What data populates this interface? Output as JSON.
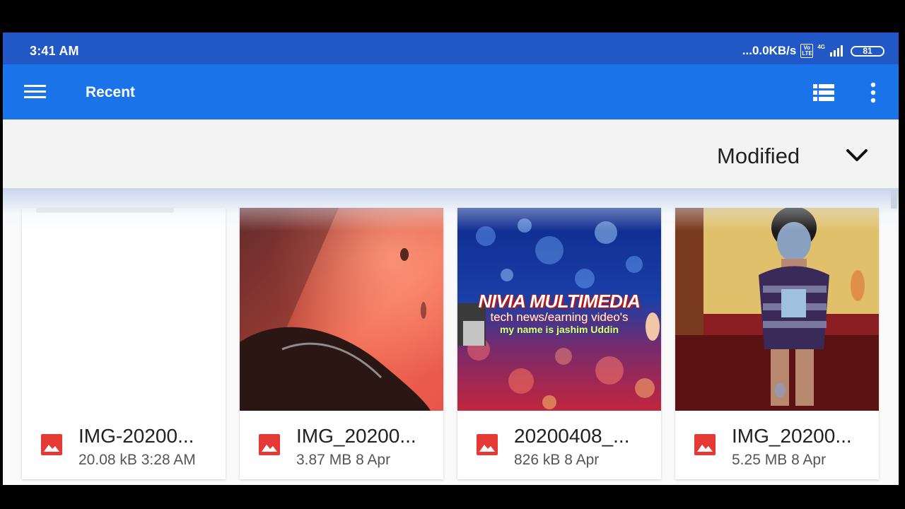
{
  "status_bar": {
    "time": "3:41 AM",
    "speed": "...0.0KB/s",
    "volte": "Vo LTE",
    "network": "4G",
    "battery": "81"
  },
  "app_bar": {
    "title": "Recent",
    "icons": [
      "menu-icon",
      "list-view-icon",
      "more-vert-icon"
    ]
  },
  "sort": {
    "label": "Modified",
    "icon": "chevron-down-icon"
  },
  "files": [
    {
      "name": "IMG-20200...",
      "size": "20.08 kB",
      "date": "3:28 AM",
      "icon": "image-icon"
    },
    {
      "name": "IMG_20200...",
      "size": "3.87 MB",
      "date": "8 Apr",
      "icon": "image-icon"
    },
    {
      "name": "20200408_...",
      "size": "826 kB",
      "date": "8 Apr",
      "icon": "image-icon"
    },
    {
      "name": "IMG_20200...",
      "size": "5.25 MB",
      "date": "8 Apr",
      "icon": "image-icon"
    }
  ],
  "thumbnail_text": {
    "line1": "NIVIA MULTIMEDIA",
    "line2": "tech news/earning video's",
    "line3": "my name is jashim Uddin"
  },
  "colors": {
    "status_bar": "#2257c6",
    "app_bar": "#1a73e8",
    "image_icon": "#e53935"
  }
}
